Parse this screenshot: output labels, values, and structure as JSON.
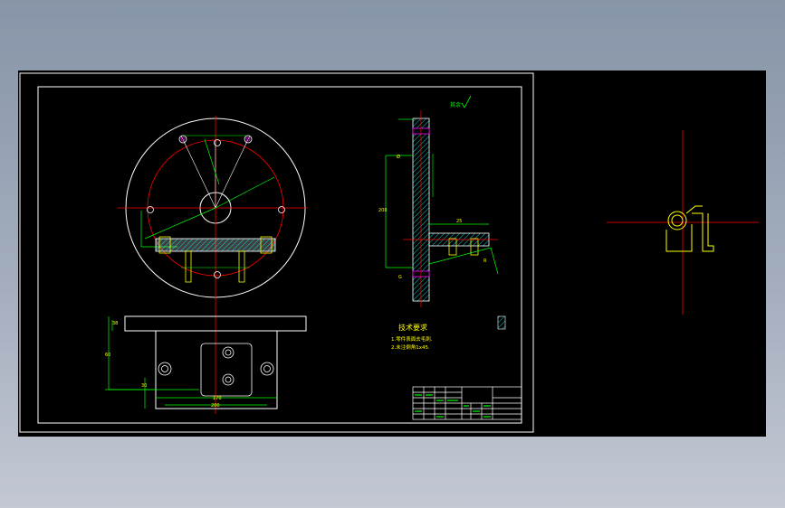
{
  "colors": {
    "background": "#000000",
    "frame": "#ffffff",
    "outline": "#ffffff",
    "centerline": "#ff0000",
    "dimension": "#00ff00",
    "hatch": "#00ffff",
    "yellow": "#ffff00",
    "magenta": "#ff00ff"
  },
  "drawing": {
    "surface_mark": "其余",
    "tech_title": "技术要求",
    "tech_notes": [
      "1.零件表面去毛刺.",
      "2.未注倒角1x45."
    ],
    "top_dims": {
      "height": "38",
      "depth": "60",
      "width": "200",
      "inner": "170",
      "small": "30"
    },
    "side_dims": {
      "d1": "Ø",
      "d2": "200",
      "d3": "25",
      "d4": "R"
    }
  }
}
